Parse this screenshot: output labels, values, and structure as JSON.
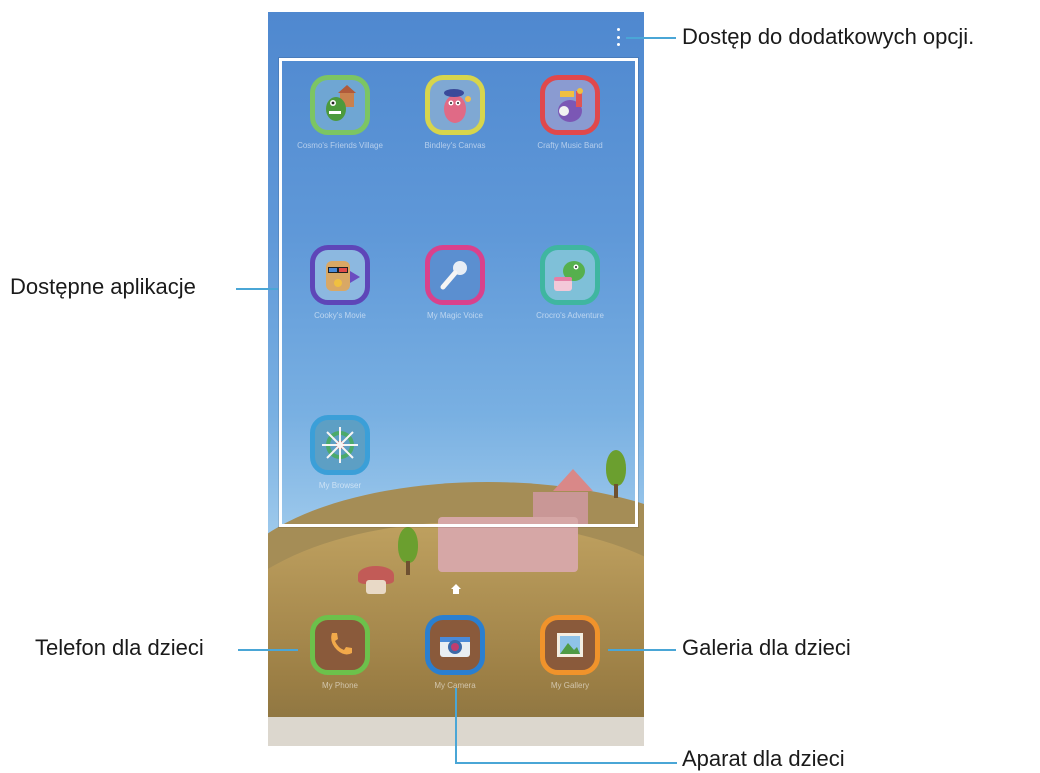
{
  "header": {
    "more_options_icon": "more-vert-icon"
  },
  "apps": [
    {
      "label": "Cosmo's Friends Village",
      "icon": "village-icon",
      "border_color": "#7cc563",
      "bg": "#6fa6d3"
    },
    {
      "label": "Bindley's Canvas",
      "icon": "canvas-icon",
      "border_color": "#d7d54c",
      "bg": "#7fa8d3"
    },
    {
      "label": "Crafty Music Band",
      "icon": "music-band-icon",
      "border_color": "#e0484b",
      "bg": "#8a9bd1"
    },
    {
      "label": "Cooky's Movie",
      "icon": "movie-icon",
      "border_color": "#5e46b8",
      "bg": "#8cb8e0"
    },
    {
      "label": "My Magic Voice",
      "icon": "microphone-icon",
      "border_color": "#d9418c",
      "bg": "#5b8fd0"
    },
    {
      "label": "Crocro's Adventure",
      "icon": "dino-cake-icon",
      "border_color": "#3fb6a0",
      "bg": "#7fc0d8"
    },
    {
      "label": "My Browser",
      "icon": "browser-wheel-icon",
      "border_color": "#3b9fd8",
      "bg": "#5d9fc4"
    }
  ],
  "dock": [
    {
      "label": "My Phone",
      "icon": "phone-icon",
      "border_color": "#6cc14b",
      "bg": "#8a5a3b"
    },
    {
      "label": "My Camera",
      "icon": "camera-icon",
      "border_color": "#2a7fd0",
      "bg": "#8a5a3b"
    },
    {
      "label": "My Gallery",
      "icon": "gallery-icon",
      "border_color": "#f0932b",
      "bg": "#8a5a3b"
    }
  ],
  "callouts": {
    "more_options": "Dostęp do dodatkowych opcji.",
    "available_apps": "Dostępne aplikacje",
    "kids_phone": "Telefon dla dzieci",
    "kids_gallery": "Galeria dla dzieci",
    "kids_camera": "Aparat dla dzieci"
  },
  "colors": {
    "callout_line": "#4aa6d6",
    "frame": "#ffffff"
  }
}
